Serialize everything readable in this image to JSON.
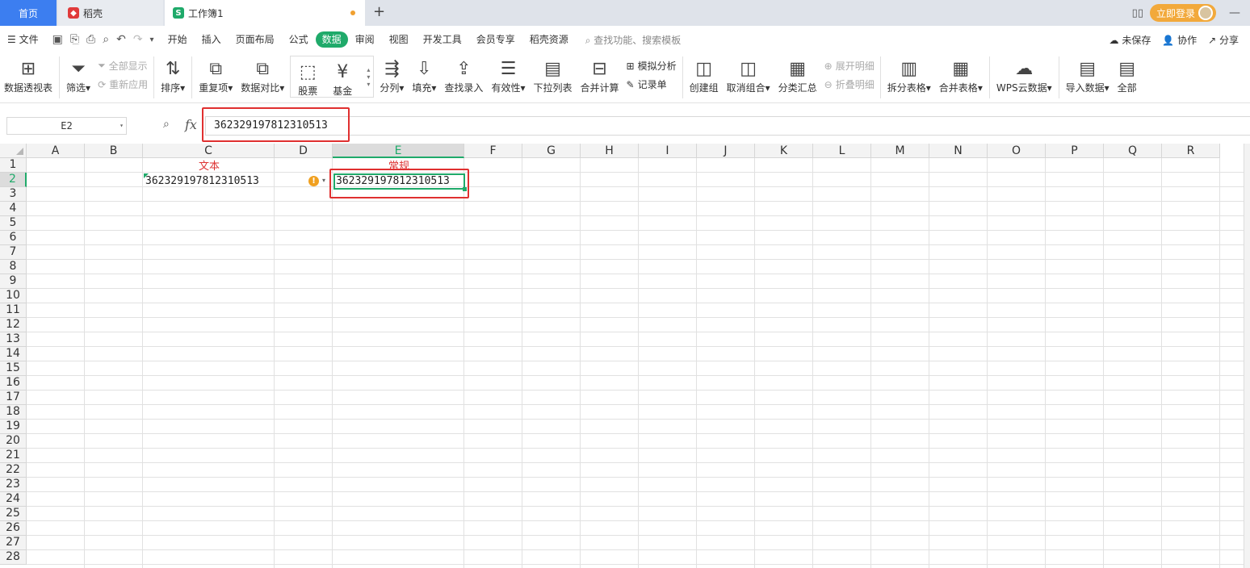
{
  "tabs": {
    "home": "首页",
    "daoke": "稻壳",
    "workbook": "工作簿1"
  },
  "titlebar": {
    "login": "立即登录"
  },
  "menu": {
    "file": "文件",
    "items": [
      "开始",
      "插入",
      "页面布局",
      "公式",
      "数据",
      "审阅",
      "视图",
      "开发工具",
      "会员专享",
      "稻壳资源"
    ],
    "active": "数据",
    "search_placeholder": "查找功能、搜索模板",
    "unsaved": "未保存",
    "collab": "协作",
    "share": "分享"
  },
  "ribbon": {
    "pivot": "数据透视表",
    "filter": "筛选",
    "show_all": "全部显示",
    "reapply": "重新应用",
    "sort": "排序",
    "duplicates": "重复项",
    "compare": "数据对比",
    "stock": "股票",
    "fund": "基金",
    "split_col": "分列",
    "fill": "填充",
    "lookup": "查找录入",
    "validity": "有效性",
    "dropdown": "下拉列表",
    "consolidate": "合并计算",
    "whatif": "模拟分析",
    "record": "记录单",
    "group": "创建组",
    "ungroup": "取消组合",
    "subtotal": "分类汇总",
    "expand": "展开明细",
    "collapse": "折叠明细",
    "split_table": "拆分表格",
    "merge_table": "合并表格",
    "wps_cloud": "WPS云数据",
    "import": "导入数据",
    "all": "全部"
  },
  "formula_bar": {
    "name_box": "E2",
    "fx": "fx",
    "value": "362329197812310513"
  },
  "columns": [
    "A",
    "B",
    "C",
    "D",
    "E",
    "F",
    "G",
    "H",
    "I",
    "J",
    "K",
    "L",
    "M",
    "N",
    "O",
    "P",
    "Q",
    "R"
  ],
  "rows": [
    "1",
    "2",
    "3",
    "4",
    "5",
    "6",
    "7",
    "8",
    "9",
    "10",
    "11",
    "12",
    "13",
    "14",
    "15",
    "16",
    "17",
    "18",
    "19",
    "20",
    "21",
    "22",
    "23",
    "24",
    "25",
    "26",
    "27",
    "28"
  ],
  "cells": {
    "C1": "文本",
    "E1": "常规",
    "C2": "362329197812310513",
    "E2": "362329197812310513"
  },
  "selected_cell": "E2"
}
